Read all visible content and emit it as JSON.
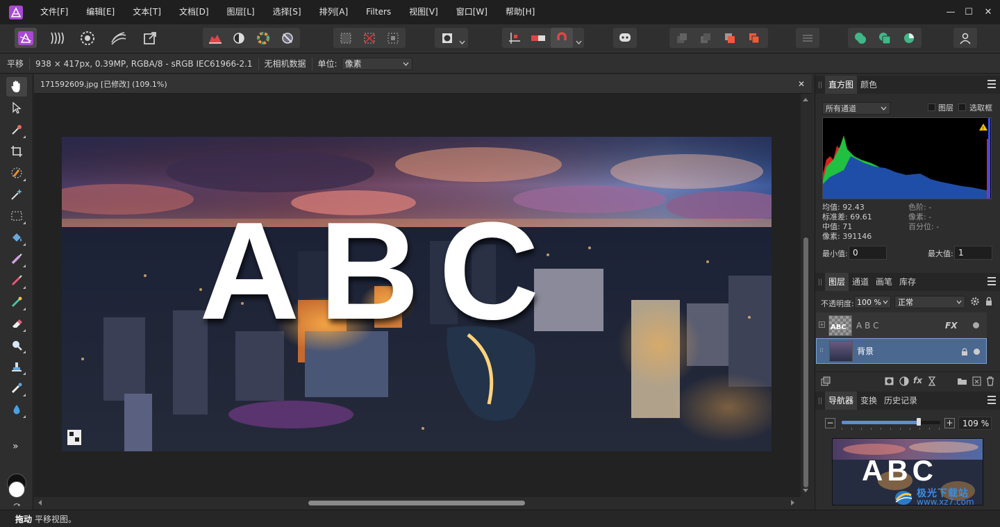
{
  "app": {
    "menu": [
      "文件[F]",
      "编辑[E]",
      "文本[T]",
      "文档[D]",
      "图层[L]",
      "选择[S]",
      "排列[A]",
      "Filters",
      "视图[V]",
      "窗口[W]",
      "帮助[H]"
    ],
    "window_controls": {
      "minimize": "—",
      "maximize": "☐",
      "close": "✕"
    }
  },
  "context": {
    "tool_name": "平移",
    "doc_info": "938 × 417px, 0.39MP, RGBA/8 - sRGB IEC61966-2.1",
    "camera_data": "无相机数据",
    "unit_label": "单位:",
    "unit_value": "像素"
  },
  "document": {
    "tab_title": "171592609.jpg [已修改] (109.1%)",
    "close": "✕",
    "artwork_text": "ABC"
  },
  "status": {
    "bold": "拖动",
    "text": "平移视图。"
  },
  "tools": {
    "more": "»"
  },
  "histogram_panel": {
    "tabs": [
      "直方图",
      "颜色"
    ],
    "channel": "所有通道",
    "cb_layer": "图层",
    "cb_selection": "选取框",
    "stats_left": [
      "均值: 92.43",
      "标准差: 69.61",
      "中值: 71",
      "像素: 391146"
    ],
    "stats_right": [
      "色阶: -",
      "像素: -",
      "百分位: -"
    ],
    "min_label": "最小值:",
    "min_value": "0",
    "max_label": "最大值:",
    "max_value": "1"
  },
  "layers_panel": {
    "tabs": [
      "图层",
      "通道",
      "画笔",
      "库存"
    ],
    "opacity_label": "不透明度:",
    "opacity_value": "100 %",
    "blend_mode": "正常",
    "layers": [
      {
        "name": "A B C",
        "fx": "FX"
      },
      {
        "name": "背景"
      }
    ]
  },
  "navigator_panel": {
    "tabs": [
      "导航器",
      "变换",
      "历史记录"
    ],
    "zoom_value": "109 %",
    "zoom_level": 0.78,
    "thumb_text": "ABC"
  },
  "watermark": {
    "text": "极光下载站",
    "url": "www.xz7.com"
  },
  "colors": {
    "accent": "#4f6fa0",
    "selected_layer": "#4a6890",
    "app_logo": "#b04ad0"
  }
}
